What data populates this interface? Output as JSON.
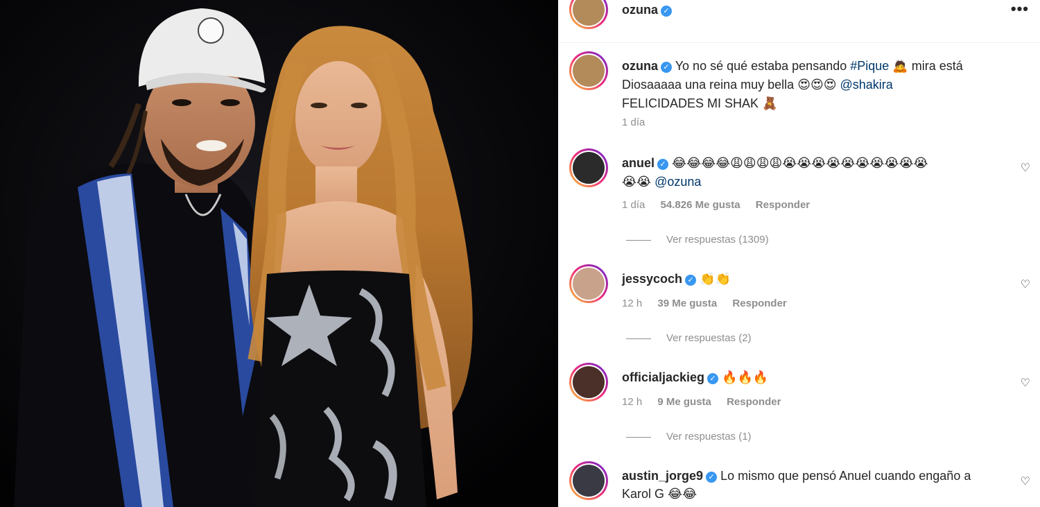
{
  "post": {
    "author": "ozuna",
    "verified_mark": "✓",
    "more_label": "•••"
  },
  "caption": {
    "user": "ozuna",
    "line1_text": "Yo no sé qué estaba pensando",
    "hashtag": "#Pique",
    "line1_emoji": "🙇",
    "line1_end": "mira está",
    "line2_text": "Diosaaaaa una reina muy bella",
    "line2_emoji": "😍😍😍",
    "mention": "@shakira",
    "line3_text": "FELICIDADES MI SHAK",
    "line3_emoji": "🧸",
    "time": "1 día"
  },
  "comments": [
    {
      "user": "anuel",
      "text_emoji": "😂😂😂😂😩😩😩😩😭😭😭😭😭😭😭😭😭😭",
      "text_line2_emoji": "😭😭",
      "mention": "@ozuna",
      "time": "1 día",
      "likes": "54.826 Me gusta",
      "reply_label": "Responder",
      "replies_label": "Ver respuestas (1309)"
    },
    {
      "user": "jessycoch",
      "text_emoji": "👏👏",
      "time": "12 h",
      "likes": "39 Me gusta",
      "reply_label": "Responder",
      "replies_label": "Ver respuestas (2)"
    },
    {
      "user": "officialjackieg",
      "text_emoji": "🔥🔥🔥",
      "time": "12 h",
      "likes": "9 Me gusta",
      "reply_label": "Responder",
      "replies_label": "Ver respuestas (1)"
    },
    {
      "user": "austin_jorge9",
      "text": "Lo mismo que pensó Anuel cuando engaño a",
      "text_line2": "Karol G",
      "text_line2_emoji": "😂😂"
    }
  ],
  "icons": {
    "heart": "♡",
    "avatar_ring_colors": [
      "#f9ce34",
      "#ee2a7b",
      "#6228d7"
    ],
    "verified_color": "#3897f0"
  }
}
